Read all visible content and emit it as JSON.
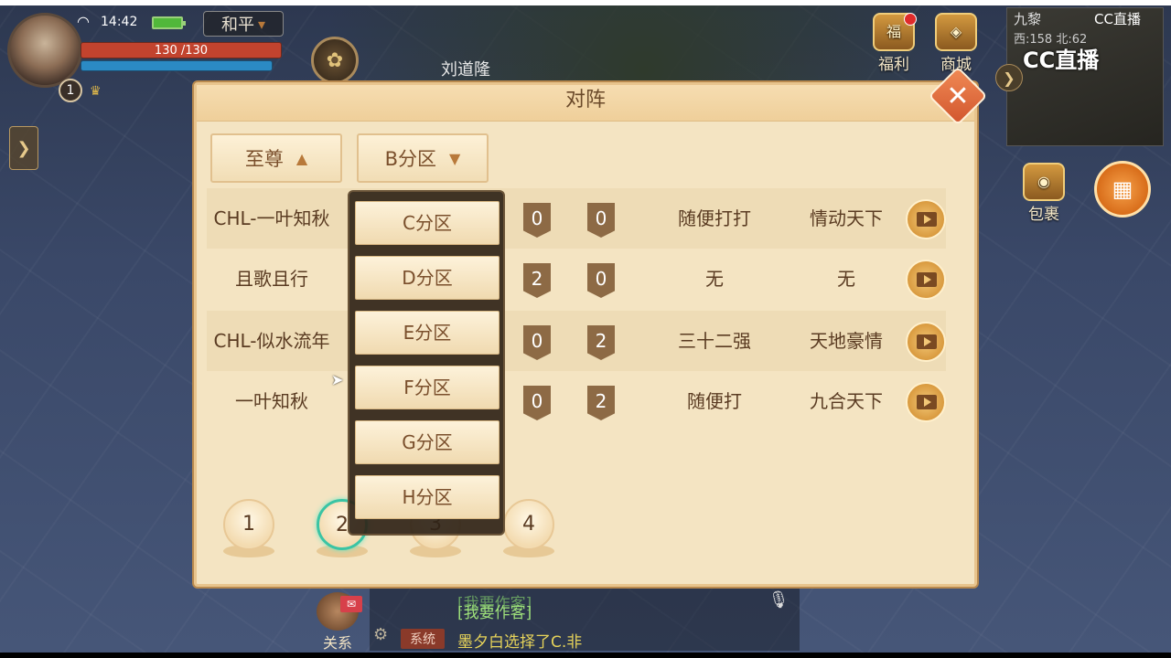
{
  "hud": {
    "clock": "14:42",
    "server": "和平",
    "level": "1",
    "hp": "130 /130",
    "npc_name": "刘道隆",
    "buttons": {
      "welfare": "福利",
      "shop": "商城",
      "bag": "包裹",
      "relations": "关系"
    },
    "map_name": "九黎",
    "coords": "西:158 北:62",
    "watermark_small": "CC直播",
    "watermark_big": "CC直播"
  },
  "panel": {
    "title": "对阵",
    "tier_select": "至尊",
    "group_select": "B分区",
    "matches": [
      {
        "team_a": "CHL-一叶知秋",
        "score_a": "0",
        "score_b": "0",
        "status": "随便打打",
        "team_b": "情动天下"
      },
      {
        "team_a": "且歌且行",
        "score_a": "2",
        "score_b": "0",
        "status": "无",
        "team_b": "无"
      },
      {
        "team_a": "CHL-似水流年",
        "score_a": "0",
        "score_b": "2",
        "status": "三十二强",
        "team_b": "天地豪情"
      },
      {
        "team_a": "一叶知秋",
        "score_a": "0",
        "score_b": "2",
        "status": "随便打",
        "team_b": "九合天下"
      }
    ],
    "pages": [
      "1",
      "2",
      "3",
      "4"
    ],
    "active_page": "2",
    "group_options": [
      "C分区",
      "D分区",
      "E分区",
      "F分区",
      "G分区",
      "H分区"
    ]
  },
  "chat": {
    "line1": "[我要作客]",
    "line2": "[我要作客]",
    "system_tag": "系统",
    "system_msg": "墨夕白选择了C.非"
  },
  "colors": {
    "panel_bg": "#f4e4c2",
    "text_brown": "#5a3b22",
    "close_orange": "#d2562e",
    "active_page_ring": "#3ac4a4"
  }
}
